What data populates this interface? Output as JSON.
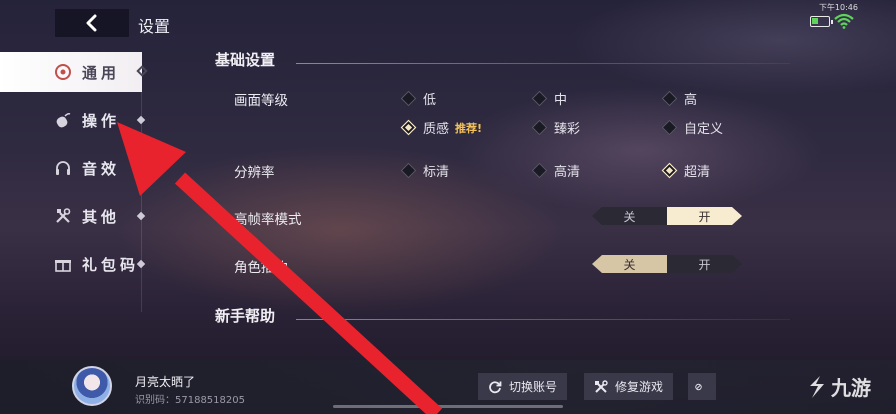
{
  "header": {
    "title": "设置"
  },
  "status_bar": {
    "time": "下午10:46"
  },
  "sidebar": {
    "items": [
      {
        "label": "通用",
        "icon": "general-icon",
        "active": true
      },
      {
        "label": "操作",
        "icon": "controller-icon",
        "active": false
      },
      {
        "label": "音效",
        "icon": "headphones-icon",
        "active": false
      },
      {
        "label": "其他",
        "icon": "tools-icon",
        "active": false
      },
      {
        "label": "礼包码",
        "icon": "gift-icon",
        "active": false
      }
    ]
  },
  "basic": {
    "title": "基础设置",
    "quality": {
      "label": "画面等级",
      "options": [
        "低",
        "中",
        "高",
        "质感",
        "臻彩",
        "自定义"
      ],
      "selected": "质感",
      "recommend_tag": "推荐!"
    },
    "resolution": {
      "label": "分辨率",
      "options": [
        "标清",
        "高清",
        "超清"
      ],
      "selected": "超清"
    },
    "high_fps": {
      "label": "高帧率模式",
      "off": "关",
      "on": "开",
      "value": "开"
    },
    "outline": {
      "label": "角色描边",
      "off": "关",
      "on": "开",
      "value": "关"
    }
  },
  "help": {
    "title": "新手帮助"
  },
  "footer": {
    "username": "月亮太晒了",
    "uid": "识别码：57188518205",
    "switch_account": "切换账号",
    "repair_game": "修复游戏"
  },
  "watermark": {
    "text": "九游"
  },
  "colors": {
    "accent": "#f7ecd0",
    "arrow": "#e8232e",
    "tag": "#f3c25c"
  }
}
